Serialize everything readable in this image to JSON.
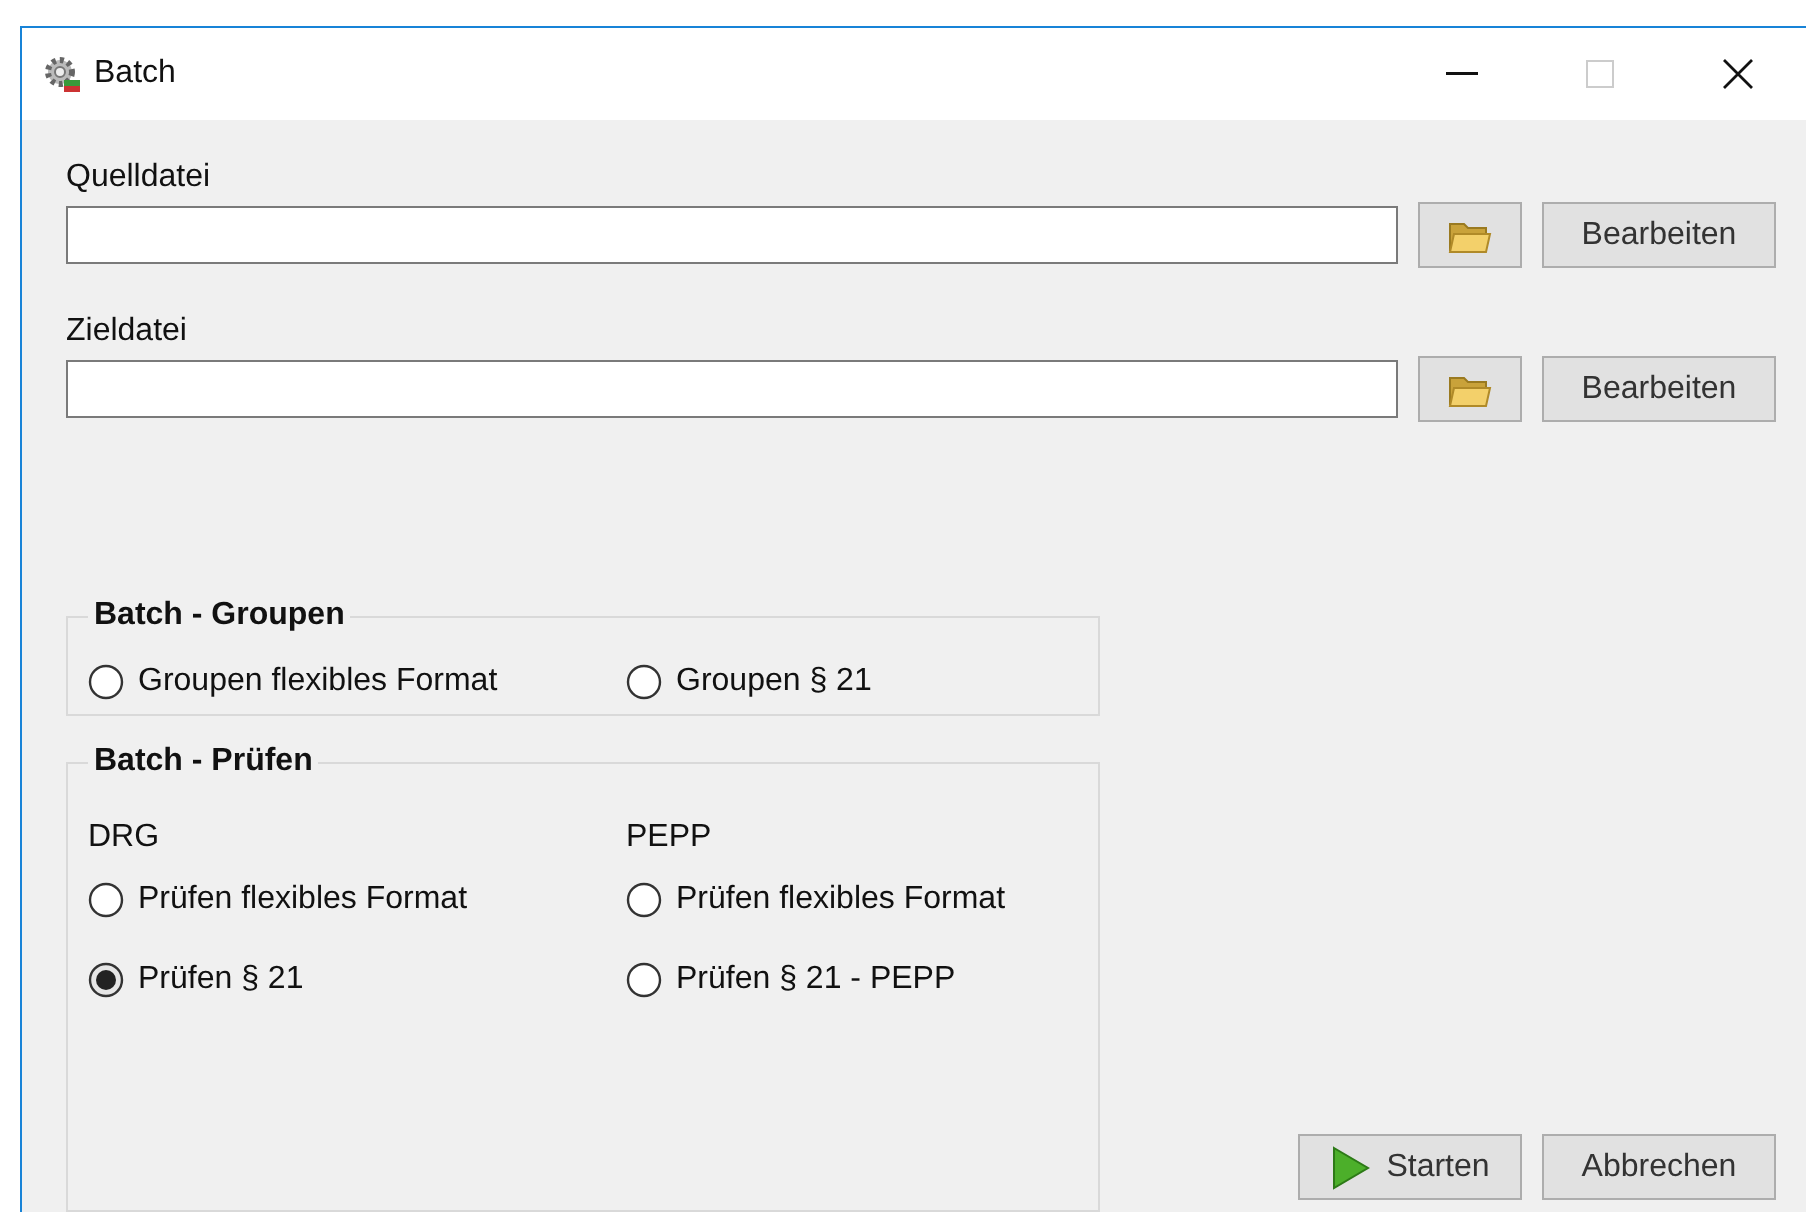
{
  "window": {
    "title": "Batch"
  },
  "source": {
    "label": "Quelldatei",
    "edit_button": "Bearbeiten"
  },
  "target": {
    "label": "Zieldatei",
    "edit_button": "Bearbeiten"
  },
  "groupen": {
    "title": "Batch - Groupen",
    "options": [
      {
        "label": "Groupen flexibles Format",
        "selected": false
      },
      {
        "label": "Groupen § 21",
        "selected": false
      }
    ]
  },
  "pruefen": {
    "title": "Batch - Prüfen",
    "columns": [
      {
        "heading": "DRG",
        "options": [
          {
            "label": "Prüfen flexibles Format",
            "selected": false
          },
          {
            "label": "Prüfen § 21",
            "selected": true
          }
        ]
      },
      {
        "heading": "PEPP",
        "options": [
          {
            "label": "Prüfen flexibles Format",
            "selected": false
          },
          {
            "label": "Prüfen § 21 - PEPP",
            "selected": false
          }
        ]
      }
    ]
  },
  "buttons": [
    {
      "label": "Starten",
      "kind": "start"
    },
    {
      "label": "Abbrechen",
      "kind": "plain"
    }
  ]
}
